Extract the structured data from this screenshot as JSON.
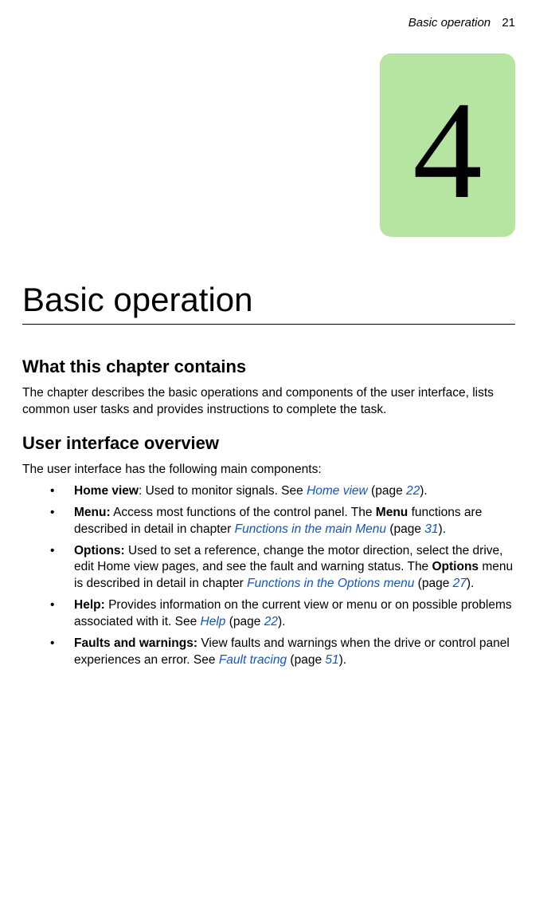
{
  "header": {
    "running_title": "Basic operation",
    "page_number": "21"
  },
  "chapter_number": "4",
  "chapter_title": "Basic operation",
  "sections": {
    "s1": {
      "heading": "What this chapter contains",
      "para": "The chapter describes the basic operations and components of the user interface, lists common user tasks and provides instructions to complete the task."
    },
    "s2": {
      "heading": "User interface overview",
      "intro": "The user interface has the following main components:",
      "items": [
        {
          "label": "Home view",
          "sep": ": ",
          "body": "Used to monitor signals. See ",
          "link_text": "Home view",
          "page_prefix": " (page ",
          "page_ref": "22",
          "page_suffix": ")."
        },
        {
          "label": "Menu:",
          "sep": " ",
          "body_a": "Access most functions of the control panel. The ",
          "inline_bold": "Menu",
          "body_b": " functions are described in detail in chapter ",
          "link_text": "Functions in the main Menu",
          "page_prefix": " (page ",
          "page_ref": "31",
          "page_suffix": ")."
        },
        {
          "label": "Options:",
          "sep": " ",
          "body_a": "Used to set a reference, change the motor direction, select the drive, edit Home view pages, and see the fault and warning status. The ",
          "inline_bold": "Options",
          "body_b": " menu is described in detail in chapter ",
          "link_text": "Functions in the Options menu",
          "page_prefix": " (page ",
          "page_ref": "27",
          "page_suffix": ")."
        },
        {
          "label": "Help:",
          "sep": " ",
          "body": "Provides information on the current view or menu or on possible problems associated with it. See ",
          "link_text": "Help",
          "page_prefix": " (page ",
          "page_ref": "22",
          "page_suffix": ")."
        },
        {
          "label": "Faults and warnings:",
          "sep": " ",
          "body": "View faults and warnings when the drive or control panel experiences an error. See ",
          "link_text": "Fault tracing",
          "page_prefix": " (page ",
          "page_ref": "51",
          "page_suffix": ")."
        }
      ]
    }
  }
}
